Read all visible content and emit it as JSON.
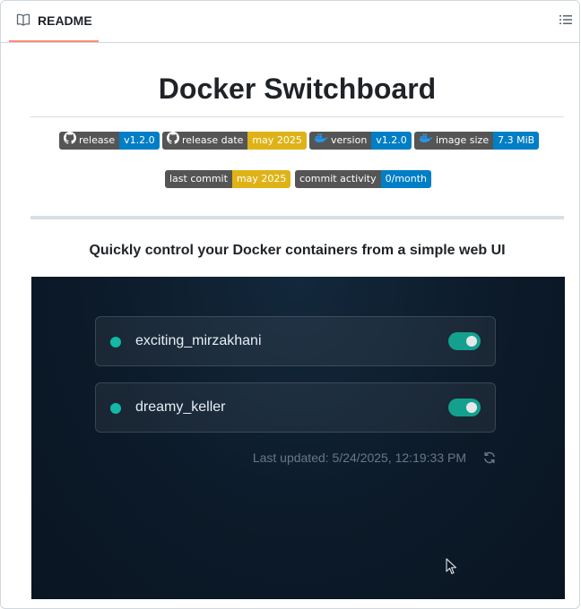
{
  "tab": {
    "label": "README",
    "icon": "book-icon"
  },
  "outline_button": {
    "icon": "list-icon"
  },
  "title": "Docker Switchboard",
  "badges_row1": [
    {
      "label": "release",
      "value": "v1.2.0",
      "icon": "github-icon",
      "color": "#007ec6"
    },
    {
      "label": "release date",
      "value": "may 2025",
      "icon": "github-icon",
      "color": "#dfb317"
    },
    {
      "label": "version",
      "value": "v1.2.0",
      "icon": "docker-icon",
      "color": "#007ec6"
    },
    {
      "label": "image size",
      "value": "7.3 MiB",
      "icon": "docker-icon",
      "color": "#007ec6"
    }
  ],
  "badges_row2": [
    {
      "label": "last commit",
      "value": "may 2025",
      "color": "#dfb317"
    },
    {
      "label": "commit activity",
      "value": "0/month",
      "color": "#007ec6"
    }
  ],
  "tagline": "Quickly control your Docker containers from a simple web UI",
  "screenshot": {
    "containers": [
      {
        "name": "exciting_mirzakhani",
        "status": "running",
        "enabled": true
      },
      {
        "name": "dreamy_keller",
        "status": "running",
        "enabled": true
      }
    ],
    "last_updated": "Last updated: 5/24/2025, 12:19:33 PM",
    "accent_color": "#14b8a6"
  }
}
